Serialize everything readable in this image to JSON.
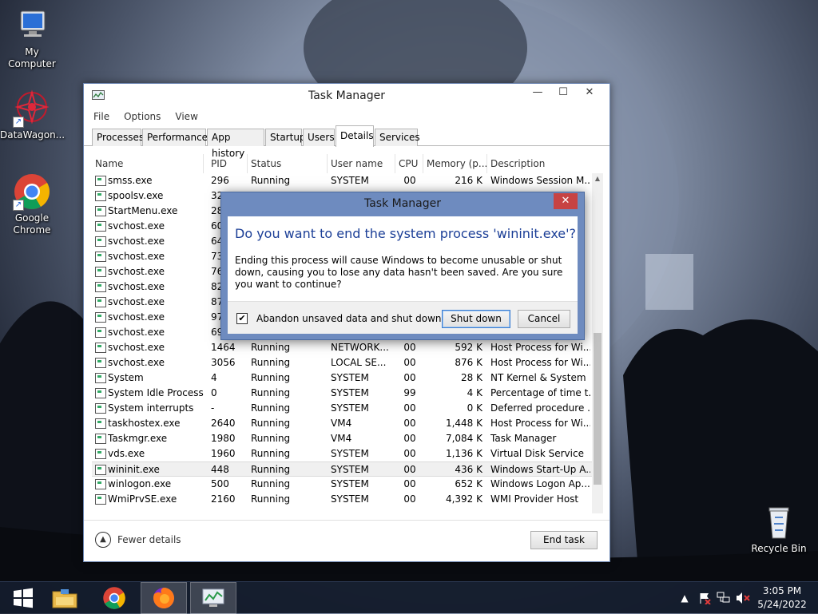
{
  "desktop": {
    "icons": [
      {
        "label": "My Computer"
      },
      {
        "label": "DataWagon..."
      },
      {
        "label": "Google Chrome"
      },
      {
        "label": "Recycle Bin"
      }
    ]
  },
  "task_manager": {
    "title": "Task Manager",
    "menu": [
      "File",
      "Options",
      "View"
    ],
    "tabs": [
      "Processes",
      "Performance",
      "App history",
      "Startup",
      "Users",
      "Details",
      "Services"
    ],
    "active_tab": "Details",
    "columns": [
      "Name",
      "PID",
      "Status",
      "User name",
      "CPU",
      "Memory (p...",
      "Description"
    ],
    "rows": [
      {
        "name": "smss.exe",
        "pid": "296",
        "status": "Running",
        "user": "SYSTEM",
        "cpu": "00",
        "mem": "216 K",
        "desc": "Windows Session M..."
      },
      {
        "name": "spoolsv.exe",
        "pid": "32",
        "status": "",
        "user": "",
        "cpu": "",
        "mem": "",
        "desc": ""
      },
      {
        "name": "StartMenu.exe",
        "pid": "28",
        "status": "",
        "user": "",
        "cpu": "",
        "mem": "",
        "desc": ""
      },
      {
        "name": "svchost.exe",
        "pid": "60",
        "status": "",
        "user": "",
        "cpu": "",
        "mem": "",
        "desc": ""
      },
      {
        "name": "svchost.exe",
        "pid": "64",
        "status": "",
        "user": "",
        "cpu": "",
        "mem": "",
        "desc": ""
      },
      {
        "name": "svchost.exe",
        "pid": "73",
        "status": "",
        "user": "",
        "cpu": "",
        "mem": "",
        "desc": ""
      },
      {
        "name": "svchost.exe",
        "pid": "76",
        "status": "",
        "user": "",
        "cpu": "",
        "mem": "",
        "desc": ""
      },
      {
        "name": "svchost.exe",
        "pid": "82",
        "status": "",
        "user": "",
        "cpu": "",
        "mem": "",
        "desc": ""
      },
      {
        "name": "svchost.exe",
        "pid": "87",
        "status": "",
        "user": "",
        "cpu": "",
        "mem": "",
        "desc": ""
      },
      {
        "name": "svchost.exe",
        "pid": "97",
        "status": "",
        "user": "",
        "cpu": "",
        "mem": "",
        "desc": ""
      },
      {
        "name": "svchost.exe",
        "pid": "69",
        "status": "",
        "user": "",
        "cpu": "",
        "mem": "",
        "desc": ""
      },
      {
        "name": "svchost.exe",
        "pid": "1464",
        "status": "Running",
        "user": "NETWORK...",
        "cpu": "00",
        "mem": "592 K",
        "desc": "Host Process for Wi..."
      },
      {
        "name": "svchost.exe",
        "pid": "3056",
        "status": "Running",
        "user": "LOCAL SE...",
        "cpu": "00",
        "mem": "876 K",
        "desc": "Host Process for Wi..."
      },
      {
        "name": "System",
        "pid": "4",
        "status": "Running",
        "user": "SYSTEM",
        "cpu": "00",
        "mem": "28 K",
        "desc": "NT Kernel & System"
      },
      {
        "name": "System Idle Process",
        "pid": "0",
        "status": "Running",
        "user": "SYSTEM",
        "cpu": "99",
        "mem": "4 K",
        "desc": "Percentage of time t..."
      },
      {
        "name": "System interrupts",
        "pid": "-",
        "status": "Running",
        "user": "SYSTEM",
        "cpu": "00",
        "mem": "0 K",
        "desc": "Deferred procedure ..."
      },
      {
        "name": "taskhostex.exe",
        "pid": "2640",
        "status": "Running",
        "user": "VM4",
        "cpu": "00",
        "mem": "1,448 K",
        "desc": "Host Process for Wi..."
      },
      {
        "name": "Taskmgr.exe",
        "pid": "1980",
        "status": "Running",
        "user": "VM4",
        "cpu": "00",
        "mem": "7,084 K",
        "desc": "Task Manager"
      },
      {
        "name": "vds.exe",
        "pid": "1960",
        "status": "Running",
        "user": "SYSTEM",
        "cpu": "00",
        "mem": "1,136 K",
        "desc": "Virtual Disk Service"
      },
      {
        "name": "wininit.exe",
        "pid": "448",
        "status": "Running",
        "user": "SYSTEM",
        "cpu": "00",
        "mem": "436 K",
        "desc": "Windows Start-Up A..."
      },
      {
        "name": "winlogon.exe",
        "pid": "500",
        "status": "Running",
        "user": "SYSTEM",
        "cpu": "00",
        "mem": "652 K",
        "desc": "Windows Logon Ap..."
      },
      {
        "name": "WmiPrvSE.exe",
        "pid": "2160",
        "status": "Running",
        "user": "SYSTEM",
        "cpu": "00",
        "mem": "4,392 K",
        "desc": "WMI Provider Host"
      }
    ],
    "selected_row": "wininit.exe",
    "fewer_details": "Fewer details",
    "end_task": "End task"
  },
  "dialog": {
    "title": "Task Manager",
    "close": "✕",
    "main_instruction": "Do you want to end the system process 'wininit.exe'?",
    "content": "Ending this process will cause Windows to become unusable or shut down, causing you to lose any data hasn't been saved. Are you sure you want to continue?",
    "checkbox_label": "Abandon unsaved data and shut down.",
    "checkbox_checked": true,
    "check_mark": "✔",
    "primary_button": "Shut down",
    "cancel_button": "Cancel"
  },
  "taskbar": {
    "time": "3:05 PM",
    "date": "5/24/2022",
    "apps": [
      "start-icon",
      "file-explorer-icon",
      "chrome-icon",
      "firefox-icon",
      "task-manager-icon"
    ]
  },
  "colors": {
    "dialog_frame": "#6e8bbf",
    "main_instruction": "#1c3f97",
    "close_button": "#c74343",
    "taskbar": "#141c2c"
  }
}
